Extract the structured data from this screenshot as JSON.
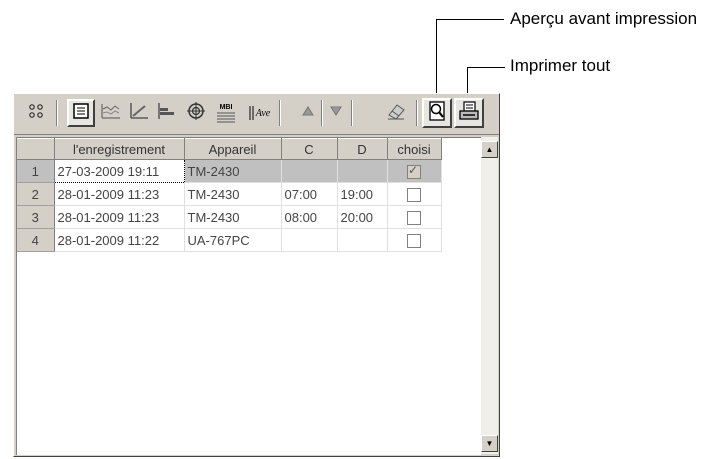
{
  "callouts": {
    "preview_label": "Aperçu avant impression",
    "print_all_label": "Imprimer tout"
  },
  "toolbar": {
    "icons": [
      "grid-dots-icon",
      "list-view-icon",
      "line-chart-icon",
      "pressure-chart-icon",
      "bar-chart-icon",
      "target-icon",
      "mbi-icon",
      "average-icon",
      "sort-up-icon",
      "sort-down-icon",
      "eraser-icon",
      "print-preview-icon",
      "print-all-icon"
    ],
    "mbi_text": "MBI",
    "ave_text": "Ave"
  },
  "table": {
    "columns": [
      "",
      "l'enregistrement",
      "Appareil",
      "C",
      "D",
      "choisi"
    ],
    "rows": [
      {
        "num": "1",
        "date": "27-03-2009 19:11",
        "device": "TM-2430",
        "c": "",
        "d": "",
        "checked": true
      },
      {
        "num": "2",
        "date": "28-01-2009 11:23",
        "device": "TM-2430",
        "c": "07:00",
        "d": "19:00",
        "checked": false
      },
      {
        "num": "3",
        "date": "28-01-2009 11:23",
        "device": "TM-2430",
        "c": "08:00",
        "d": "20:00",
        "checked": false
      },
      {
        "num": "4",
        "date": "28-01-2009 11:22",
        "device": "UA-767PC",
        "c": "",
        "d": "",
        "checked": false
      }
    ]
  },
  "scrollbar": {
    "up_icon": "▲",
    "down_icon": "▼"
  }
}
